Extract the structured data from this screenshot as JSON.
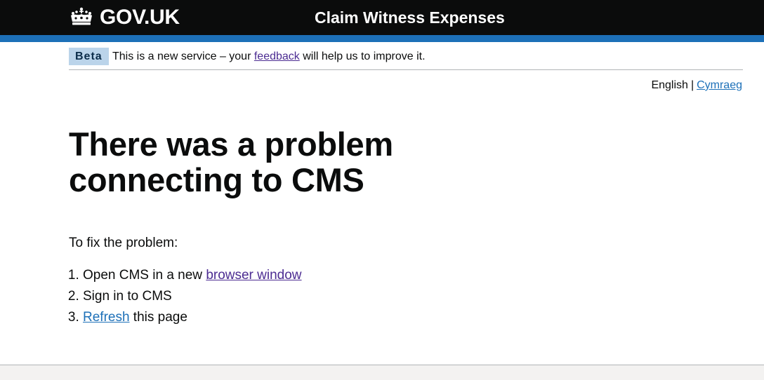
{
  "header": {
    "logo_text": "GOV.UK",
    "logo_icon": "crown-icon",
    "service_name": "Claim Witness Expenses",
    "background_color": "#0b0c0c",
    "accent_color": "#1d70b8"
  },
  "phase_banner": {
    "tag": "Beta",
    "text_before": "This is a new service – your ",
    "link": "feedback",
    "text_after": " will help us to improve it."
  },
  "language": {
    "current": "English",
    "divider": "|",
    "alternate": "Cymraeg"
  },
  "main": {
    "title": "There was a problem connecting to CMS",
    "intro": "To fix the problem:",
    "steps": [
      {
        "before": "Open CMS in a new ",
        "link": "browser window",
        "after": ""
      },
      {
        "text": "Sign in to CMS"
      },
      {
        "link": "Refresh",
        "after": " this page"
      }
    ]
  }
}
